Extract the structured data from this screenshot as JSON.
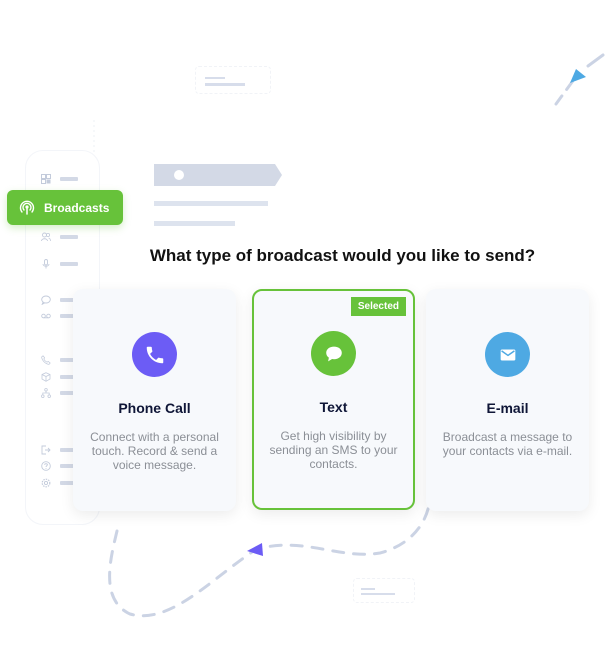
{
  "sidebar": {
    "active_item": {
      "label": "Broadcasts",
      "icon": "broadcast-antenna-icon",
      "color": "#67c23a"
    },
    "items": [
      {
        "icon": "grid-icon"
      },
      {
        "icon": "contacts-icon"
      },
      {
        "icon": "microphone-icon"
      },
      {
        "icon": "chat-bubble-icon"
      },
      {
        "icon": "voicemail-icon"
      },
      {
        "icon": "phone-icon"
      },
      {
        "icon": "package-icon"
      },
      {
        "icon": "org-chart-icon"
      },
      {
        "icon": "logout-icon"
      },
      {
        "icon": "help-icon"
      },
      {
        "icon": "settings-icon"
      }
    ]
  },
  "question": "What type of broadcast would you like to send?",
  "options": [
    {
      "id": "phone",
      "title": "Phone Call",
      "description": "Connect with a personal touch. Record & send a voice message.",
      "icon": "phone-icon",
      "color": "#6c5cf5",
      "selected": false
    },
    {
      "id": "text",
      "title": "Text",
      "description": "Get high visibility by sending an SMS to your contacts.",
      "icon": "chat-bubble-icon",
      "color": "#67c23a",
      "selected": true,
      "badge": "Selected"
    },
    {
      "id": "email",
      "title": "E-mail",
      "description": "Broadcast a message to your contacts via e-mail.",
      "icon": "envelope-icon",
      "color": "#4ea9e3",
      "selected": false
    }
  ],
  "colors": {
    "accent_green": "#67c23a",
    "accent_purple": "#6c5cf5",
    "accent_blue": "#4ea9e3",
    "title_navy": "#0f1637",
    "muted_text": "#8b8f96",
    "decor_gray": "#d3d9e6"
  }
}
